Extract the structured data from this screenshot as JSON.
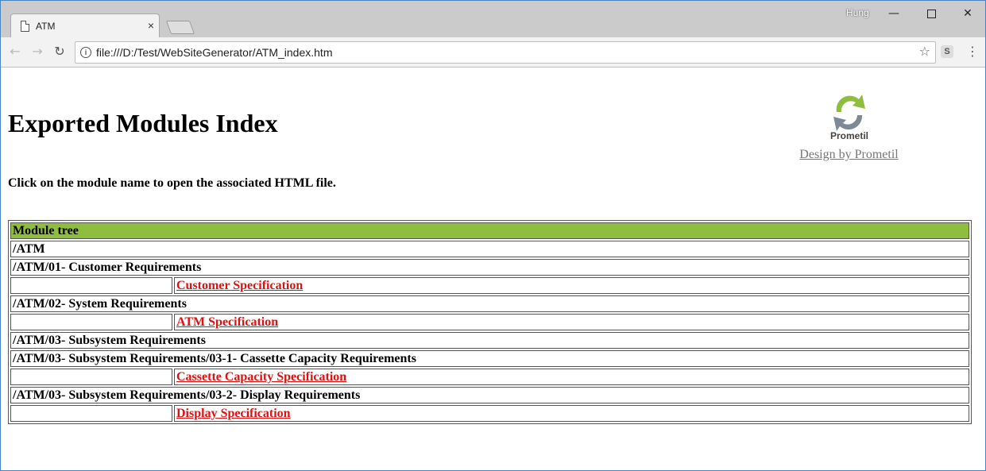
{
  "browser": {
    "tab_title": "ATM",
    "tab_close": "×",
    "profile_name": "Hung",
    "window_controls": {
      "minimize": "—",
      "maximize": "",
      "close": "✕"
    },
    "nav": {
      "back": "←",
      "forward": "→",
      "reload": "↻",
      "info": "i",
      "star": "☆",
      "extension": "S",
      "menu": "⋮"
    },
    "url": "file:///D:/Test/WebSiteGenerator/ATM_index.htm"
  },
  "page": {
    "title": "Exported Modules Index",
    "instructions": "Click on the module name to open the associated HTML file.",
    "logo_text": "Prometil",
    "credit_link": "Design by Prometil",
    "table_header": "Module tree",
    "rows": [
      {
        "kind": "path",
        "text": "/ATM"
      },
      {
        "kind": "path",
        "text": "/ATM/01- Customer Requirements"
      },
      {
        "kind": "link",
        "text": "Customer Specification"
      },
      {
        "kind": "path",
        "text": "/ATM/02- System Requirements"
      },
      {
        "kind": "link",
        "text": "ATM Specification"
      },
      {
        "kind": "path",
        "text": "/ATM/03- Subsystem Requirements"
      },
      {
        "kind": "path",
        "text": "/ATM/03- Subsystem Requirements/03-1- Cassette Capacity Requirements"
      },
      {
        "kind": "link",
        "text": "Cassette Capacity Specification"
      },
      {
        "kind": "path",
        "text": "/ATM/03- Subsystem Requirements/03-2- Display Requirements"
      },
      {
        "kind": "link",
        "text": "Display Specification"
      }
    ]
  },
  "colors": {
    "header_green": "#8fbd3f",
    "link_red": "#dd1111",
    "credit_gray": "#777777"
  },
  "icons": [
    "document-icon",
    "close-icon",
    "new-tab-icon",
    "back-arrow-icon",
    "forward-arrow-icon",
    "reload-icon",
    "info-icon",
    "star-icon",
    "extension-icon",
    "menu-icon",
    "prometil-logo"
  ]
}
